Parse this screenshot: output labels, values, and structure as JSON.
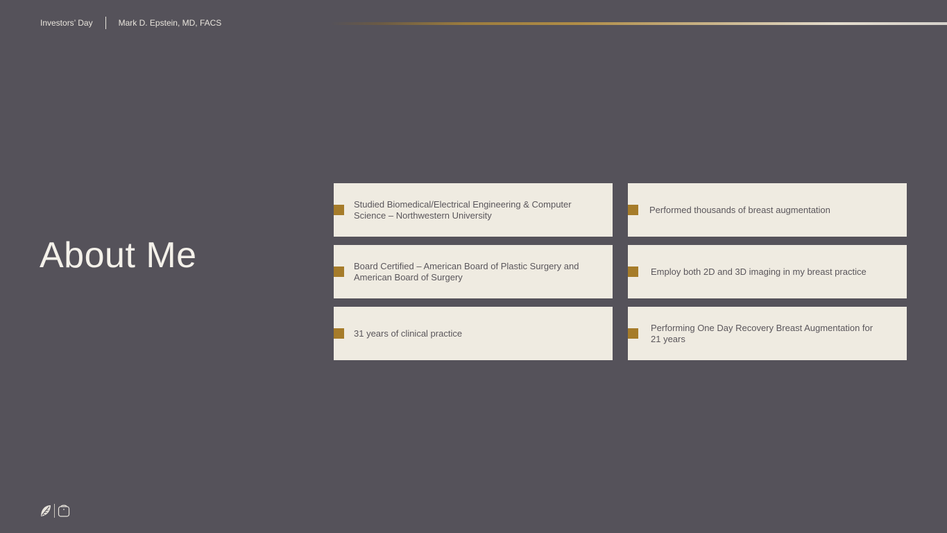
{
  "header": {
    "event": "Investors’ Day",
    "presenter": "Mark D. Epstein, MD, FACS"
  },
  "slide": {
    "title": "About Me"
  },
  "cards": [
    {
      "text": "Studied Biomedical/Electrical Engineering & Computer Science – Northwestern University"
    },
    {
      "text": "Performed thousands of breast augmentation"
    },
    {
      "text": "Board Certified – American Board of Plastic Surgery and American Board of Surgery"
    },
    {
      "text": "Employ both 2D and 3D imaging in my breast practice"
    },
    {
      "text": "31 years of clinical practice"
    },
    {
      "text": "Performing One Day Recovery Breast Augmentation for 21 years"
    }
  ],
  "colors": {
    "background": "#55525a",
    "card": "#efebe1",
    "accent": "#a67c2a"
  },
  "icons": {
    "left_logo": "leaf-logo-icon",
    "right_logo": "bag-logo-icon"
  }
}
